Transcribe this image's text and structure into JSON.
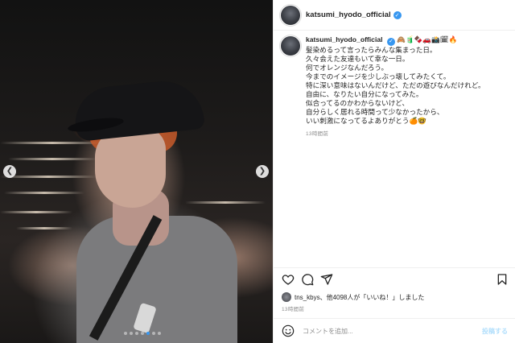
{
  "post": {
    "username": "katsumi_hyodo_official",
    "caption_emojis": "🙈🧃🍫🚗📸🗓🔥",
    "caption_lines": [
      "髪染めるって言ったらみんな集まった日。",
      "久々会えた友達もいて幸な一日。",
      "何でオレンジなんだろう。",
      "今までのイメージを少しぶっ壊してみたくて。",
      "特に深い意味はないんだけど、ただの遊びなんだけれど。",
      "自由に、なりたい自分になってみた。",
      "似合ってるのかわからないけど、",
      "自分らしく居れる時間って少なかったから、",
      "いい刺激になってるよありがとう🍊🤓"
    ],
    "caption_time": "13時間前",
    "likes_text": "tns_kbys、他4098人が「いいね！」しました",
    "likes_time": "13時間前",
    "icons": {
      "verified": "verified-badge-icon",
      "like": "heart-icon",
      "comment": "comment-bubble-icon",
      "share": "paper-plane-icon",
      "save": "bookmark-icon",
      "emoji": "smiley-icon",
      "prev": "chevron-left-icon",
      "next": "chevron-right-icon"
    },
    "carousel": {
      "total": 7,
      "active_index": 4
    }
  },
  "comment": {
    "placeholder": "コメントを追加...",
    "post_label": "投稿する"
  },
  "colors": {
    "accent": "#3897f0",
    "post_button_disabled": "#b2dffc",
    "meta_text": "#8e8e8e"
  }
}
